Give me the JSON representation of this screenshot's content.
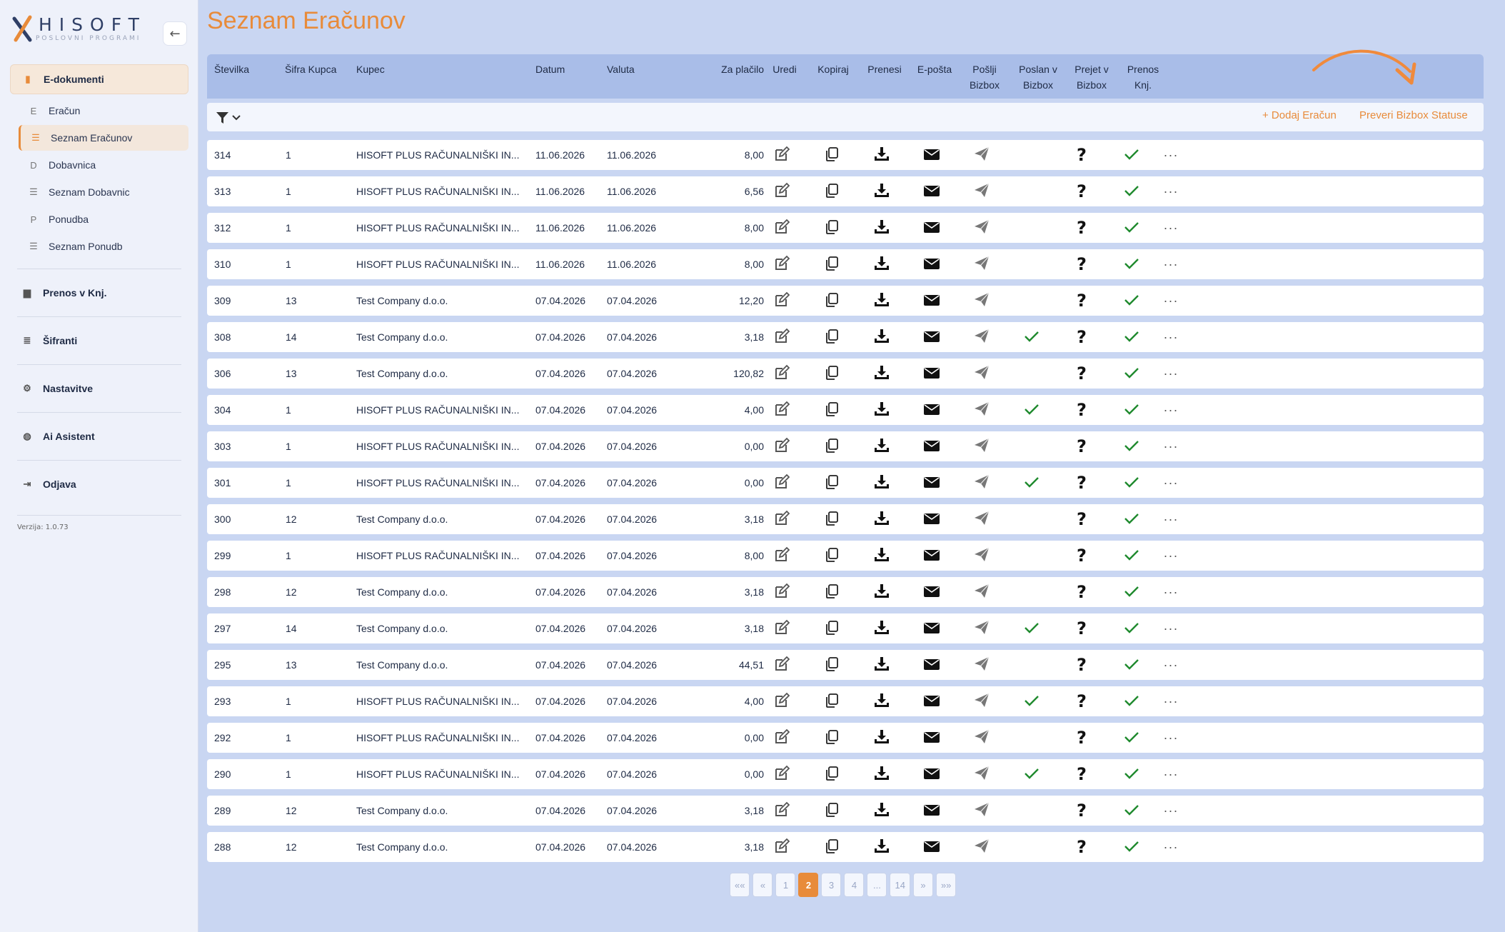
{
  "brand": {
    "name": "HISOFT",
    "tagline": "POSLOVNI PROGRAMI"
  },
  "sidebar": {
    "groups": [
      {
        "label": "E-dokumenti",
        "icon": "document-icon",
        "active": true
      },
      {
        "label": "Prenos v Knj.",
        "icon": "book-icon"
      },
      {
        "label": "Šifranti",
        "icon": "database-icon"
      },
      {
        "label": "Nastavitve",
        "icon": "gear-icon"
      },
      {
        "label": "Ai Asistent",
        "icon": "brain-icon"
      },
      {
        "label": "Odjava",
        "icon": "logout-icon"
      }
    ],
    "items": [
      {
        "label": "Eračun",
        "glyph": "E"
      },
      {
        "label": "Seznam Eračunov",
        "glyph": "list",
        "active": true
      },
      {
        "label": "Dobavnica",
        "glyph": "D"
      },
      {
        "label": "Seznam Dobavnic",
        "glyph": "list"
      },
      {
        "label": "Ponudba",
        "glyph": "P"
      },
      {
        "label": "Seznam Ponudb",
        "glyph": "list"
      }
    ],
    "version": "Verzija: 1.0.73"
  },
  "page": {
    "title": "Seznam Eračunov"
  },
  "table": {
    "headers": {
      "stevilka": "Številka",
      "sifra": "Šifra Kupca",
      "kupec": "Kupec",
      "datum": "Datum",
      "valuta": "Valuta",
      "zaplacilo": "Za plačilo",
      "uredi": "Uredi",
      "kopiraj": "Kopiraj",
      "prenesi": "Prenesi",
      "eposta": "E-pošta",
      "poslji1": "Pošlji",
      "poslji2": "Bizbox",
      "poslan1": "Poslan v",
      "poslan2": "Bizbox",
      "prejet1": "Prejet v",
      "prejet2": "Bizbox",
      "prenos1": "Prenos",
      "prenos2": "Knj."
    },
    "toolbar": {
      "add": "+ Dodaj Eračun",
      "check": "Preveri Bizbox Statuse"
    },
    "rows": [
      {
        "st": "314",
        "sifra": "1",
        "kupec": "HISOFT PLUS RAČUNALNIŠKI IN...",
        "datum": "11.06.2026",
        "valuta": "11.06.2026",
        "znesek": "8,00",
        "poslan": false
      },
      {
        "st": "313",
        "sifra": "1",
        "kupec": "HISOFT PLUS RAČUNALNIŠKI IN...",
        "datum": "11.06.2026",
        "valuta": "11.06.2026",
        "znesek": "6,56",
        "poslan": false
      },
      {
        "st": "312",
        "sifra": "1",
        "kupec": "HISOFT PLUS RAČUNALNIŠKI IN...",
        "datum": "11.06.2026",
        "valuta": "11.06.2026",
        "znesek": "8,00",
        "poslan": false
      },
      {
        "st": "310",
        "sifra": "1",
        "kupec": "HISOFT PLUS RAČUNALNIŠKI IN...",
        "datum": "11.06.2026",
        "valuta": "11.06.2026",
        "znesek": "8,00",
        "poslan": false
      },
      {
        "st": "309",
        "sifra": "13",
        "kupec": "Test Company d.o.o.",
        "datum": "07.04.2026",
        "valuta": "07.04.2026",
        "znesek": "12,20",
        "poslan": false
      },
      {
        "st": "308",
        "sifra": "14",
        "kupec": "Test Company d.o.o.",
        "datum": "07.04.2026",
        "valuta": "07.04.2026",
        "znesek": "3,18",
        "poslan": true
      },
      {
        "st": "306",
        "sifra": "13",
        "kupec": "Test Company d.o.o.",
        "datum": "07.04.2026",
        "valuta": "07.04.2026",
        "znesek": "120,82",
        "poslan": false
      },
      {
        "st": "304",
        "sifra": "1",
        "kupec": "HISOFT PLUS RAČUNALNIŠKI IN...",
        "datum": "07.04.2026",
        "valuta": "07.04.2026",
        "znesek": "4,00",
        "poslan": true
      },
      {
        "st": "303",
        "sifra": "1",
        "kupec": "HISOFT PLUS RAČUNALNIŠKI IN...",
        "datum": "07.04.2026",
        "valuta": "07.04.2026",
        "znesek": "0,00",
        "poslan": false
      },
      {
        "st": "301",
        "sifra": "1",
        "kupec": "HISOFT PLUS RAČUNALNIŠKI IN...",
        "datum": "07.04.2026",
        "valuta": "07.04.2026",
        "znesek": "0,00",
        "poslan": true
      },
      {
        "st": "300",
        "sifra": "12",
        "kupec": "Test Company d.o.o.",
        "datum": "07.04.2026",
        "valuta": "07.04.2026",
        "znesek": "3,18",
        "poslan": false
      },
      {
        "st": "299",
        "sifra": "1",
        "kupec": "HISOFT PLUS RAČUNALNIŠKI IN...",
        "datum": "07.04.2026",
        "valuta": "07.04.2026",
        "znesek": "8,00",
        "poslan": false
      },
      {
        "st": "298",
        "sifra": "12",
        "kupec": "Test Company d.o.o.",
        "datum": "07.04.2026",
        "valuta": "07.04.2026",
        "znesek": "3,18",
        "poslan": false
      },
      {
        "st": "297",
        "sifra": "14",
        "kupec": "Test Company d.o.o.",
        "datum": "07.04.2026",
        "valuta": "07.04.2026",
        "znesek": "3,18",
        "poslan": true
      },
      {
        "st": "295",
        "sifra": "13",
        "kupec": "Test Company d.o.o.",
        "datum": "07.04.2026",
        "valuta": "07.04.2026",
        "znesek": "44,51",
        "poslan": false
      },
      {
        "st": "293",
        "sifra": "1",
        "kupec": "HISOFT PLUS RAČUNALNIŠKI IN...",
        "datum": "07.04.2026",
        "valuta": "07.04.2026",
        "znesek": "4,00",
        "poslan": true
      },
      {
        "st": "292",
        "sifra": "1",
        "kupec": "HISOFT PLUS RAČUNALNIŠKI IN...",
        "datum": "07.04.2026",
        "valuta": "07.04.2026",
        "znesek": "0,00",
        "poslan": false
      },
      {
        "st": "290",
        "sifra": "1",
        "kupec": "HISOFT PLUS RAČUNALNIŠKI IN...",
        "datum": "07.04.2026",
        "valuta": "07.04.2026",
        "znesek": "0,00",
        "poslan": true
      },
      {
        "st": "289",
        "sifra": "12",
        "kupec": "Test Company d.o.o.",
        "datum": "07.04.2026",
        "valuta": "07.04.2026",
        "znesek": "3,18",
        "poslan": false
      },
      {
        "st": "288",
        "sifra": "12",
        "kupec": "Test Company d.o.o.",
        "datum": "07.04.2026",
        "valuta": "07.04.2026",
        "znesek": "3,18",
        "poslan": false
      }
    ],
    "status": {
      "prejet": "?",
      "prenos": true,
      "more": "···"
    }
  },
  "pagination": {
    "pages": [
      "««",
      "«",
      "1",
      "2",
      "3",
      "4",
      "...",
      "14",
      "»",
      "»»"
    ],
    "current": "2"
  },
  "colors": {
    "accent": "#e88b3a",
    "check": "#1f8a2e",
    "header": "#a9bde8"
  }
}
